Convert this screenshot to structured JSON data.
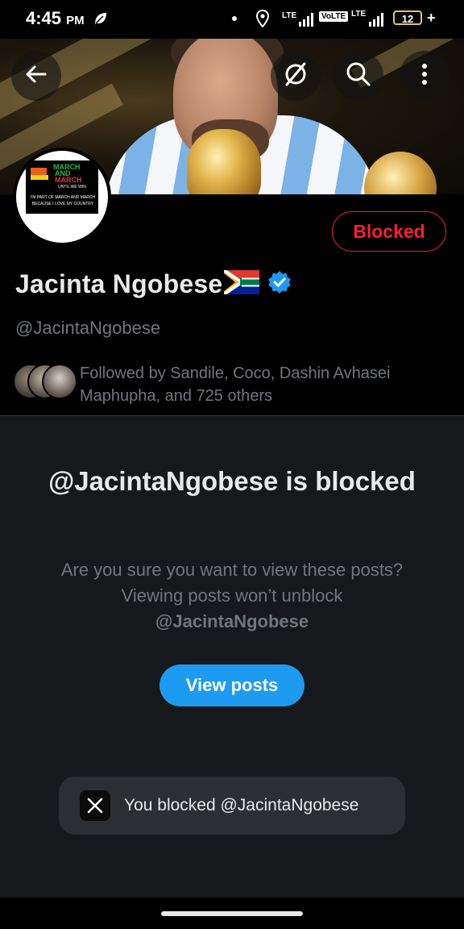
{
  "status_bar": {
    "time": "4:45",
    "ampm": "PM",
    "network1": "LTE",
    "volte": "VoLTE",
    "network2": "LTE",
    "battery": "12",
    "charging": "+"
  },
  "header": {
    "back_icon": "arrow-left-icon",
    "grok_icon": "grok-icon",
    "search_icon": "search-icon",
    "more_icon": "more-vertical-icon"
  },
  "avatar_card": {
    "line1": "MARCH",
    "line2": "AND",
    "line3": "MARCH",
    "line4": "UNTIL WE WIN",
    "line5": "I'M PART OF MARCH AND MARCH BECAUSE I LOVE MY COUNTRY"
  },
  "profile": {
    "name": "Jacinta Ngobese",
    "handle": "@JacintaNgobese",
    "blocked_label": "Blocked",
    "followed_by": "Followed by Sandile, Coco, Dashin Avhasei Maphupha, and 725 others"
  },
  "blocked_notice": {
    "title": "@JacintaNgobese is blocked",
    "description": "Are you sure you want to view these posts? Viewing posts won’t unblock",
    "handle": "@JacintaNgobese",
    "view_posts_label": "View posts"
  },
  "toast": {
    "logo_icon": "x-logo-icon",
    "message": "You blocked @JacintaNgobese"
  },
  "colors": {
    "accent_blue": "#1d9bf0",
    "blocked_red": "#f4212e",
    "verified_blue": "#1d9bf0",
    "secondary_text": "#71767b"
  }
}
